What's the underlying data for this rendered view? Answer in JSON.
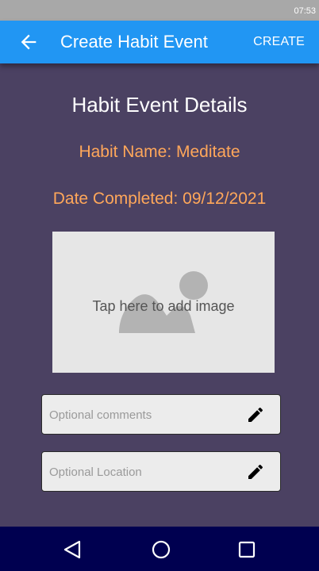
{
  "status_bar": {
    "time": "07:53"
  },
  "app_bar": {
    "title": "Create Habit Event",
    "create_label": "CREATE",
    "back_icon": "arrow-left-icon"
  },
  "details": {
    "heading": "Habit Event Details",
    "habit_name": "Habit Name: Meditate",
    "date_completed": "Date Completed: 09/12/2021"
  },
  "image_picker": {
    "hint": "Tap here to add image",
    "icon": "image-placeholder-icon"
  },
  "fields": {
    "comments_placeholder": "Optional comments",
    "location_placeholder": "Optional Location",
    "edit_icon": "pencil-icon"
  },
  "nav_bar": {
    "back_icon": "triangle-back-icon",
    "home_icon": "circle-home-icon",
    "recents_icon": "square-recents-icon"
  },
  "colors": {
    "background": "#4b4162",
    "app_bar": "#2196f3",
    "accent_text": "#ffa75a",
    "nav_bar": "#000050",
    "status_bar": "#a8a8a8"
  }
}
